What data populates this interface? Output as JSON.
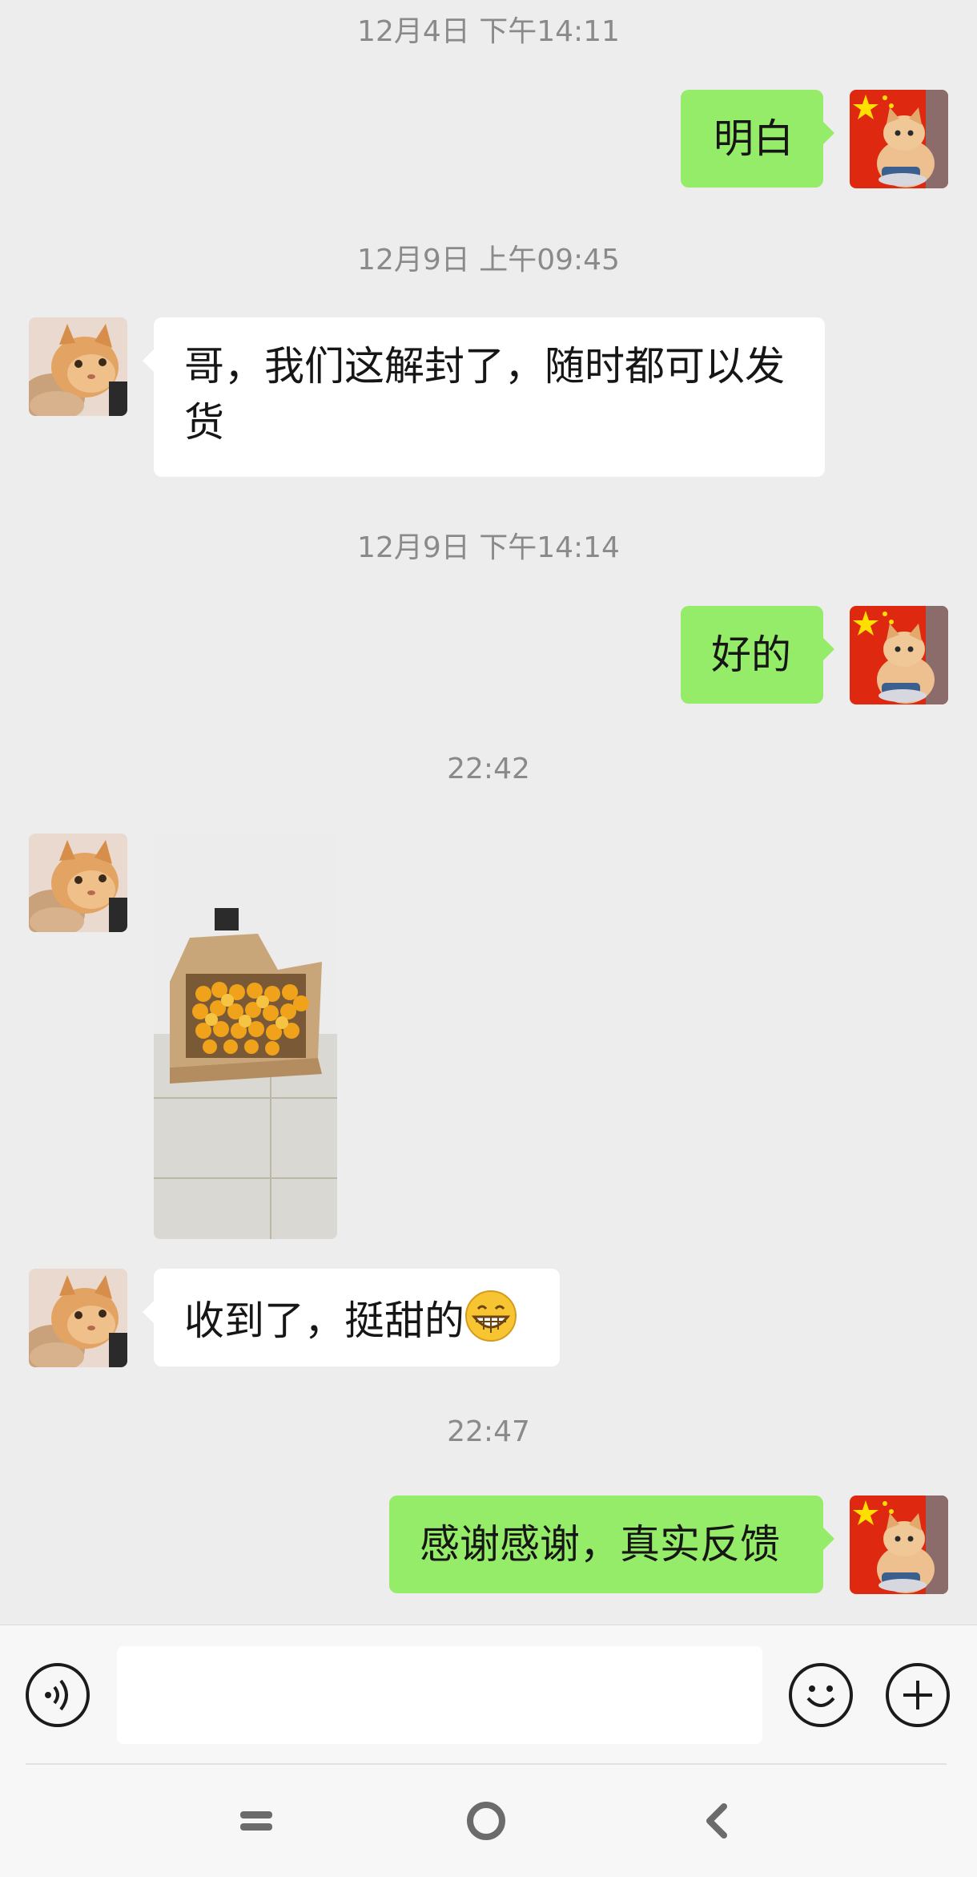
{
  "messages": {
    "ts1": "12月4日 下午14:11",
    "m1": "明白",
    "ts2": "12月9日 上午09:45",
    "m2": "哥，我们这解封了，随时都可以发货",
    "ts3": "12月9日 下午14:14",
    "m3": "好的",
    "ts4": "22:42",
    "m5": "收到了，挺甜的",
    "ts5": "22:47",
    "m6": "感谢感谢，真实反馈"
  },
  "icons": {
    "voice": "voice-icon",
    "emoji": "emoji-icon",
    "more": "plus-icon",
    "nav_menu": "menu-icon",
    "nav_home": "home-icon",
    "nav_back": "back-icon",
    "inline_emoji": "grin-emoji"
  },
  "colors": {
    "background": "#ededed",
    "outgoing_bubble": "#95ec69",
    "incoming_bubble": "#ffffff",
    "timestamp_text": "#8a8a8a"
  },
  "input": {
    "value": ""
  }
}
